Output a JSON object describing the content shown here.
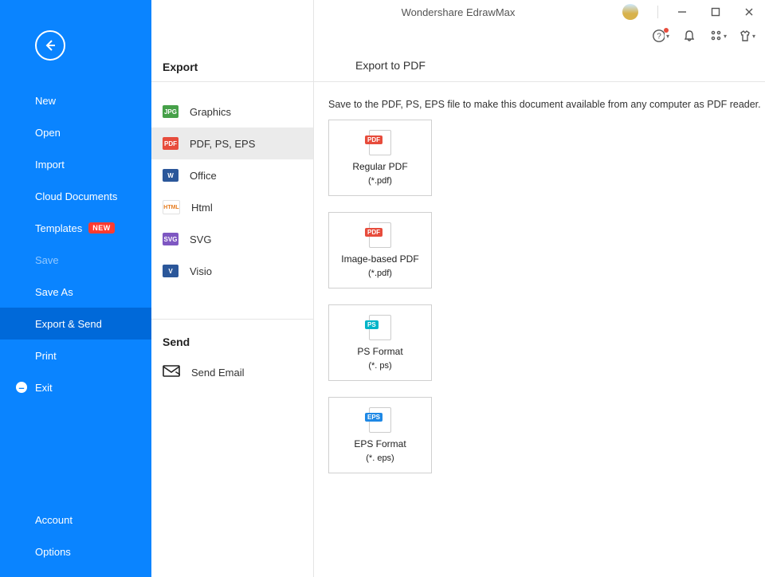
{
  "app": {
    "title": "Wondershare EdrawMax"
  },
  "sidebar": {
    "items": [
      {
        "label": "New"
      },
      {
        "label": "Open"
      },
      {
        "label": "Import"
      },
      {
        "label": "Cloud Documents"
      },
      {
        "label": "Templates",
        "badge": "NEW"
      },
      {
        "label": "Save"
      },
      {
        "label": "Save As"
      },
      {
        "label": "Export & Send"
      },
      {
        "label": "Print"
      },
      {
        "label": "Exit"
      }
    ],
    "bottom": [
      {
        "label": "Account"
      },
      {
        "label": "Options"
      }
    ]
  },
  "export": {
    "header": "Export",
    "items": [
      {
        "label": "Graphics",
        "icon": "JPG",
        "color": "fi-jpg"
      },
      {
        "label": "PDF, PS, EPS",
        "icon": "PDF",
        "color": "fi-pdf"
      },
      {
        "label": "Office",
        "icon": "W",
        "color": "fi-w"
      },
      {
        "label": "Html",
        "icon": "HTML",
        "color": "fi-html"
      },
      {
        "label": "SVG",
        "icon": "SVG",
        "color": "fi-svg"
      },
      {
        "label": "Visio",
        "icon": "V",
        "color": "fi-v"
      }
    ],
    "send_header": "Send",
    "send": {
      "label": "Send Email"
    }
  },
  "detail": {
    "title": "Export to PDF",
    "hint": "Save to the PDF, PS, EPS file to make this document available from any computer as PDF reader.",
    "cards": [
      {
        "title": "Regular PDF",
        "ext": "(*.pdf)",
        "tag_label": "PDF",
        "tag_class": "t-pdf"
      },
      {
        "title": "Image-based PDF",
        "ext": "(*.pdf)",
        "tag_label": "PDF",
        "tag_class": "t-pdf"
      },
      {
        "title": "PS Format",
        "ext": "(*. ps)",
        "tag_label": "PS",
        "tag_class": "t-ps"
      },
      {
        "title": "EPS Format",
        "ext": "(*. eps)",
        "tag_label": "EPS",
        "tag_class": "t-eps"
      }
    ]
  }
}
